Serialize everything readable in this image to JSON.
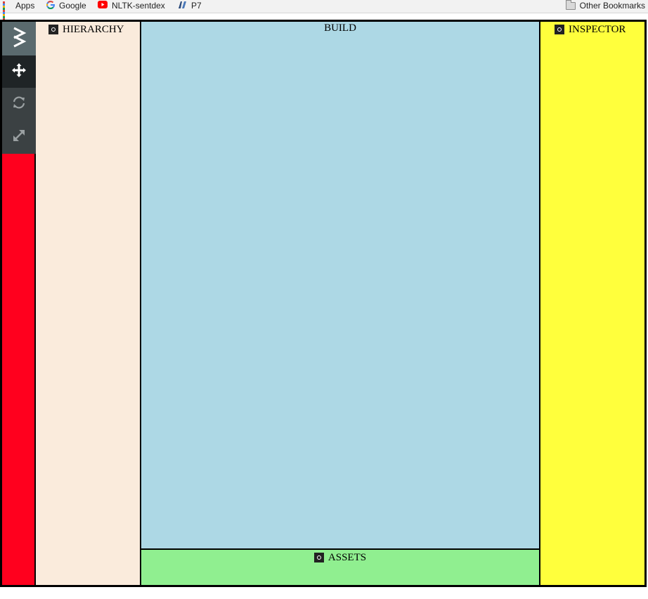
{
  "bookmarks": {
    "items": [
      {
        "label": "Apps",
        "icon": "apps-grid-icon"
      },
      {
        "label": "Google",
        "icon": "google-icon"
      },
      {
        "label": "NLTK-sentdex",
        "icon": "youtube-icon"
      },
      {
        "label": "P7",
        "icon": "site-icon"
      }
    ],
    "other": {
      "label": "Other Bookmarks",
      "icon": "folder-icon"
    }
  },
  "toolbar": {
    "tools": [
      {
        "name": "logo",
        "icon": "logo-chevrons-icon",
        "active": true,
        "color": "#5a6a6e"
      },
      {
        "name": "move",
        "icon": "move-arrows-icon",
        "active": true,
        "color": "#1f2426"
      },
      {
        "name": "rotate",
        "icon": "rotate-icon",
        "active": false,
        "color": "#3b4143"
      },
      {
        "name": "scale",
        "icon": "scale-icon",
        "active": false,
        "color": "#3b4143"
      }
    ],
    "background": "#ff001e"
  },
  "panels": {
    "hierarchy": {
      "title": "HIERARCHY",
      "color": "#faebdc"
    },
    "build": {
      "title": "BUILD",
      "color": "#add8e5"
    },
    "assets": {
      "title": "ASSETS",
      "color": "#90ef90"
    },
    "inspector": {
      "title": "INSPECTOR",
      "color": "#ffff3c"
    }
  }
}
